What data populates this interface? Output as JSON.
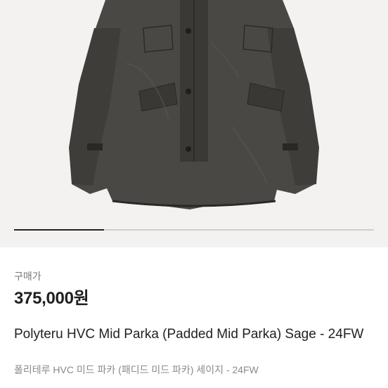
{
  "product": {
    "image_icon": "parka-product-photo",
    "carousel": {
      "current": 1,
      "total": 4
    },
    "price_label": "구매가",
    "price": "375,000원",
    "title": "Polyteru HVC Mid Parka (Padded Mid Parka) Sage - 24FW",
    "subtitle": "폴리테루 HVC 미드 파카 (패디드 미드 파카) 세이지 - 24FW"
  },
  "colors": {
    "jacket": "#4a4845",
    "background": "#f3f2f0",
    "accent": "#222222"
  }
}
